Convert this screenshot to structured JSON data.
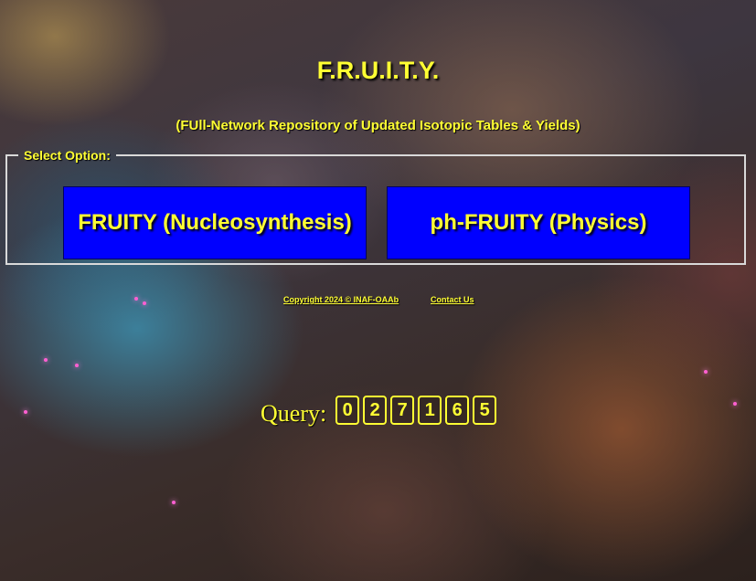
{
  "header": {
    "title": "F.R.U.I.T.Y.",
    "subtitle": "(FUll-Network Repository of Updated Isotopic Tables & Yields)"
  },
  "options": {
    "legend": "Select Option:",
    "buttons": [
      {
        "label": "FRUITY (Nucleosynthesis)"
      },
      {
        "label": "ph-FRUITY (Physics)"
      }
    ]
  },
  "footer": {
    "copyright": "Copyright 2024 © INAF-OAAb",
    "contact": "Contact Us"
  },
  "counter": {
    "label": "Query:",
    "digits": [
      "0",
      "2",
      "7",
      "1",
      "6",
      "5"
    ]
  },
  "colors": {
    "text": "#ffff33",
    "button_bg": "#0000ff"
  }
}
